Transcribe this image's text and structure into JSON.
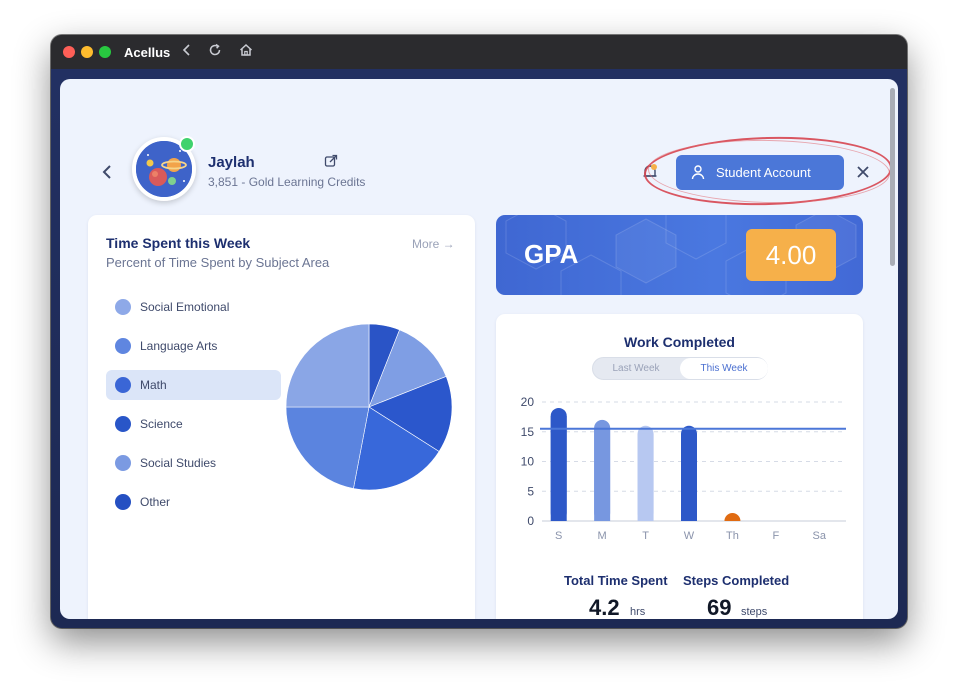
{
  "app": {
    "title": "Acellus",
    "titlebar_icons": [
      "back-arrow-icon",
      "reload-icon",
      "home-icon"
    ]
  },
  "profile": {
    "name": "Jaylah",
    "credits": "3,851 - Gold Learning Credits",
    "online": true
  },
  "header": {
    "student_account_label": "Student Account",
    "accent_color": "#4b77d8"
  },
  "time_spent": {
    "title": "Time Spent this Week",
    "subtitle": "Percent of Time Spent by Subject Area",
    "more_label": "More →",
    "legend": [
      {
        "label": "Social Emotional",
        "color": "#8ea9e8",
        "selected": false
      },
      {
        "label": "Language Arts",
        "color": "#5f86e0",
        "selected": false
      },
      {
        "label": "Math",
        "color": "#3a66d6",
        "selected": true
      },
      {
        "label": "Science",
        "color": "#2956c8",
        "selected": false
      },
      {
        "label": "Social Studies",
        "color": "#7b9ae2",
        "selected": false
      },
      {
        "label": "Other",
        "color": "#2550c2",
        "selected": false
      }
    ]
  },
  "chart_data": [
    {
      "type": "pie",
      "slices": [
        {
          "color": "#2a54c6",
          "value": 6
        },
        {
          "color": "#7f9ee4",
          "value": 13
        },
        {
          "color": "#2b57cc",
          "value": 15
        },
        {
          "color": "#3868da",
          "value": 19
        },
        {
          "color": "#5b84df",
          "value": 22
        },
        {
          "color": "#8aa6e6",
          "value": 25
        }
      ]
    },
    {
      "type": "bar",
      "title": "Work Completed",
      "categories": [
        "S",
        "M",
        "T",
        "W",
        "Th",
        "F",
        "Sa"
      ],
      "values": [
        19,
        17,
        16,
        16,
        0,
        0,
        0
      ],
      "bar_colors": [
        "#2d58c8",
        "#7797e0",
        "#b7c8f1",
        "#2d58c8",
        "#e06b12",
        "#2d58c8",
        "#2d58c8"
      ],
      "reference_line": 15.5,
      "reference_color": "#4b77d8",
      "ylim": [
        0,
        20
      ],
      "yticks": [
        0,
        5,
        10,
        15,
        20
      ],
      "grid": true
    }
  ],
  "gpa": {
    "label": "GPA",
    "value": "4.00",
    "badge_color": "#f6b04a"
  },
  "work_completed": {
    "title": "Work Completed",
    "toggle": {
      "last_week": "Last Week",
      "this_week": "This Week",
      "selected": "This Week"
    },
    "total_time_label": "Total Time Spent",
    "total_time_value": "4.2",
    "total_time_unit": "hrs",
    "steps_label": "Steps Completed",
    "steps_value": "69",
    "steps_unit": "steps"
  }
}
